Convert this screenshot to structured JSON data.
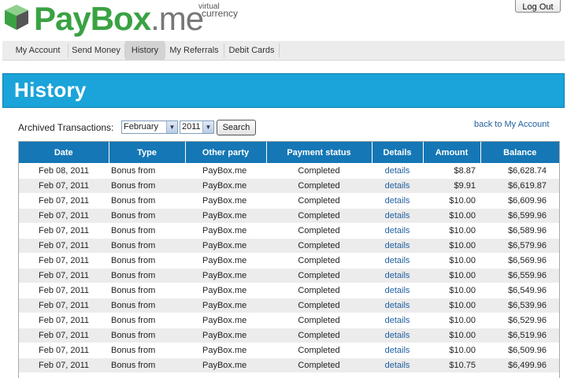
{
  "brand": {
    "pay": "PayBox",
    "box": "",
    "dot_me": ".me",
    "tagline_1": "virtual",
    "tagline_2": "currency"
  },
  "header": {
    "logout_label": "Log Out"
  },
  "nav": {
    "items": [
      {
        "label": "My Account"
      },
      {
        "label": "Send Money"
      },
      {
        "label": "History"
      },
      {
        "label": "My Referrals"
      },
      {
        "label": "Debit Cards"
      }
    ],
    "active": "History"
  },
  "page": {
    "title": "History"
  },
  "filter": {
    "label": "Archived Transactions:",
    "month": "February",
    "year": "2011",
    "search_label": "Search",
    "back_link": "back to My Account"
  },
  "table": {
    "headers": [
      "Date",
      "Type",
      "Other party",
      "Payment status",
      "Details",
      "Amount",
      "Balance"
    ],
    "rows": [
      [
        "Feb 08, 2011",
        "Bonus from",
        "PayBox.me",
        "Completed",
        "details",
        "$8.87",
        "$6,628.74"
      ],
      [
        "Feb 07, 2011",
        "Bonus from",
        "PayBox.me",
        "Completed",
        "details",
        "$9.91",
        "$6,619.87"
      ],
      [
        "Feb 07, 2011",
        "Bonus from",
        "PayBox.me",
        "Completed",
        "details",
        "$10.00",
        "$6,609.96"
      ],
      [
        "Feb 07, 2011",
        "Bonus from",
        "PayBox.me",
        "Completed",
        "details",
        "$10.00",
        "$6,599.96"
      ],
      [
        "Feb 07, 2011",
        "Bonus from",
        "PayBox.me",
        "Completed",
        "details",
        "$10.00",
        "$6,589.96"
      ],
      [
        "Feb 07, 2011",
        "Bonus from",
        "PayBox.me",
        "Completed",
        "details",
        "$10.00",
        "$6,579.96"
      ],
      [
        "Feb 07, 2011",
        "Bonus from",
        "PayBox.me",
        "Completed",
        "details",
        "$10.00",
        "$6,569.96"
      ],
      [
        "Feb 07, 2011",
        "Bonus from",
        "PayBox.me",
        "Completed",
        "details",
        "$10.00",
        "$6,559.96"
      ],
      [
        "Feb 07, 2011",
        "Bonus from",
        "PayBox.me",
        "Completed",
        "details",
        "$10.00",
        "$6,549.96"
      ],
      [
        "Feb 07, 2011",
        "Bonus from",
        "PayBox.me",
        "Completed",
        "details",
        "$10.00",
        "$6,539.96"
      ],
      [
        "Feb 07, 2011",
        "Bonus from",
        "PayBox.me",
        "Completed",
        "details",
        "$10.00",
        "$6,529.96"
      ],
      [
        "Feb 07, 2011",
        "Bonus from",
        "PayBox.me",
        "Completed",
        "details",
        "$10.00",
        "$6,519.96"
      ],
      [
        "Feb 07, 2011",
        "Bonus from",
        "PayBox.me",
        "Completed",
        "details",
        "$10.00",
        "$6,509.96"
      ],
      [
        "Feb 07, 2011",
        "Bonus from",
        "PayBox.me",
        "Completed",
        "details",
        "$10.75",
        "$6,499.96"
      ]
    ]
  },
  "colors": {
    "accent": "#1aa4d9",
    "table_header": "#1577b5",
    "brand_green": "#3aa243",
    "link": "#1f5f9e"
  },
  "icons": {
    "logo": "paybox-cube-icon",
    "dropdown": "chevron-down-icon"
  }
}
